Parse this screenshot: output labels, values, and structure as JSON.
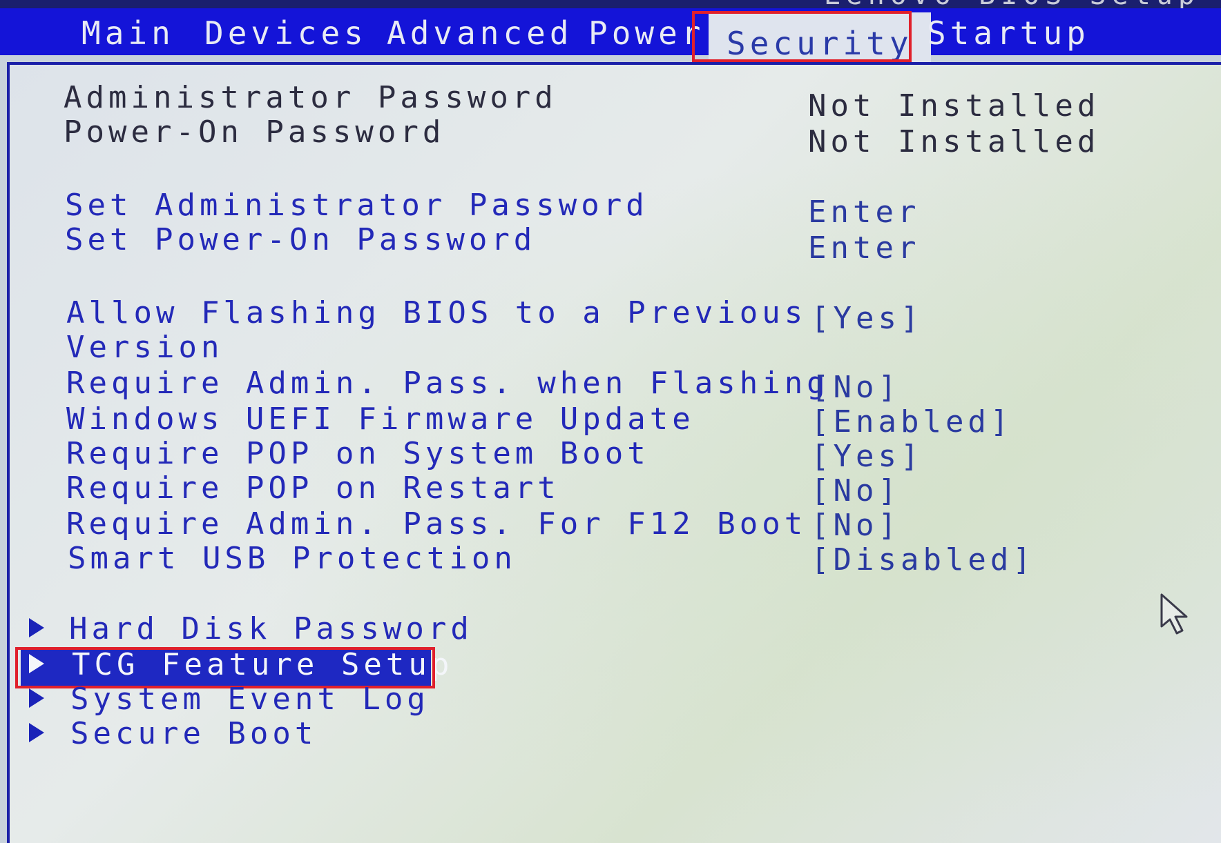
{
  "bios_title": "Lenovo BIOS Setup",
  "tabs": [
    {
      "label": "Main"
    },
    {
      "label": "Devices"
    },
    {
      "label": "Advanced"
    },
    {
      "label": "Power"
    },
    {
      "label": "Security"
    },
    {
      "label": "Startup"
    }
  ],
  "status": [
    {
      "label": "Administrator Password",
      "value": "Not Installed"
    },
    {
      "label": "Power-On Password",
      "value": "Not Installed"
    }
  ],
  "actions": [
    {
      "label": "Set Administrator Password",
      "value": "Enter"
    },
    {
      "label": "Set Power-On Password",
      "value": "Enter"
    }
  ],
  "settings": [
    {
      "label": "Allow Flashing BIOS to a Previous",
      "label2": "Version",
      "value": "[Yes]"
    },
    {
      "label": "Require Admin. Pass. when Flashing",
      "value": "[No]"
    },
    {
      "label": "Windows UEFI Firmware Update",
      "value": "[Enabled]"
    },
    {
      "label": "Require POP on System Boot",
      "value": "[Yes]"
    },
    {
      "label": "Require POP on Restart",
      "value": "[No]"
    },
    {
      "label": "Require Admin. Pass. For F12 Boot",
      "value": "[No]"
    },
    {
      "label": "Smart USB Protection",
      "value": "[Disabled]"
    }
  ],
  "submenus": [
    {
      "label": "Hard Disk Password"
    },
    {
      "label": "TCG Feature Setup"
    },
    {
      "label": "System Event Log"
    },
    {
      "label": "Secure Boot"
    }
  ],
  "colors": {
    "menubar": "#1414d8",
    "highlight_box": "#e0202c",
    "option_text": "#2329b8",
    "selected_bg": "#1e28c2"
  }
}
